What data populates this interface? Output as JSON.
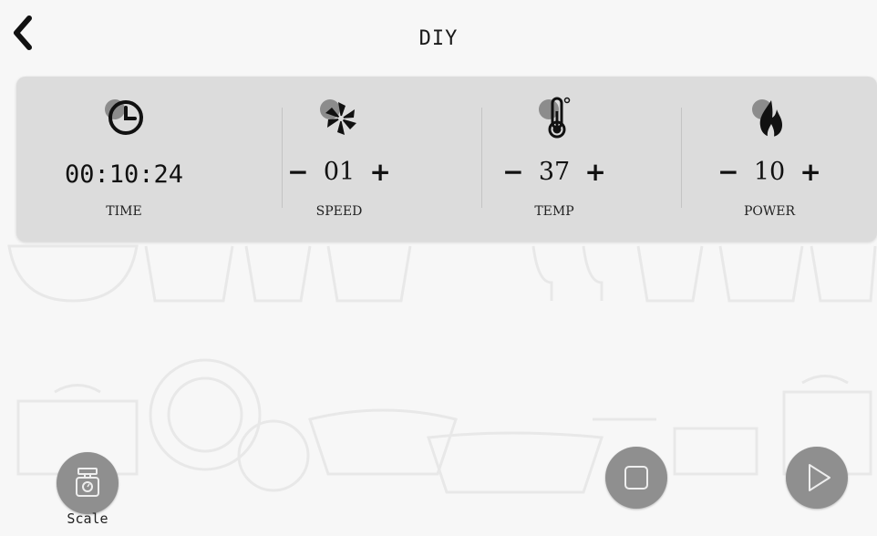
{
  "header": {
    "title": "DIY"
  },
  "time": {
    "value": "00:10:24",
    "label": "TIME"
  },
  "speed": {
    "value": "01",
    "label": "SPEED",
    "minus": "−",
    "plus": "+"
  },
  "temp": {
    "value": "37",
    "label": "TEMP",
    "minus": "−",
    "plus": "+"
  },
  "power": {
    "value": "10",
    "label": "POWER",
    "minus": "−",
    "plus": "+"
  },
  "bottom": {
    "scale_label": "Scale"
  },
  "icons": {
    "back": "chevron-left-icon",
    "time": "clock-icon",
    "speed": "fan-icon",
    "temp": "thermometer-icon",
    "power": "flame-icon",
    "scale": "scale-icon",
    "stop": "stop-icon",
    "play": "play-icon"
  },
  "colors": {
    "panel": "#dcdcdc",
    "button": "#8f8f8f",
    "background": "#f7f7f7"
  }
}
